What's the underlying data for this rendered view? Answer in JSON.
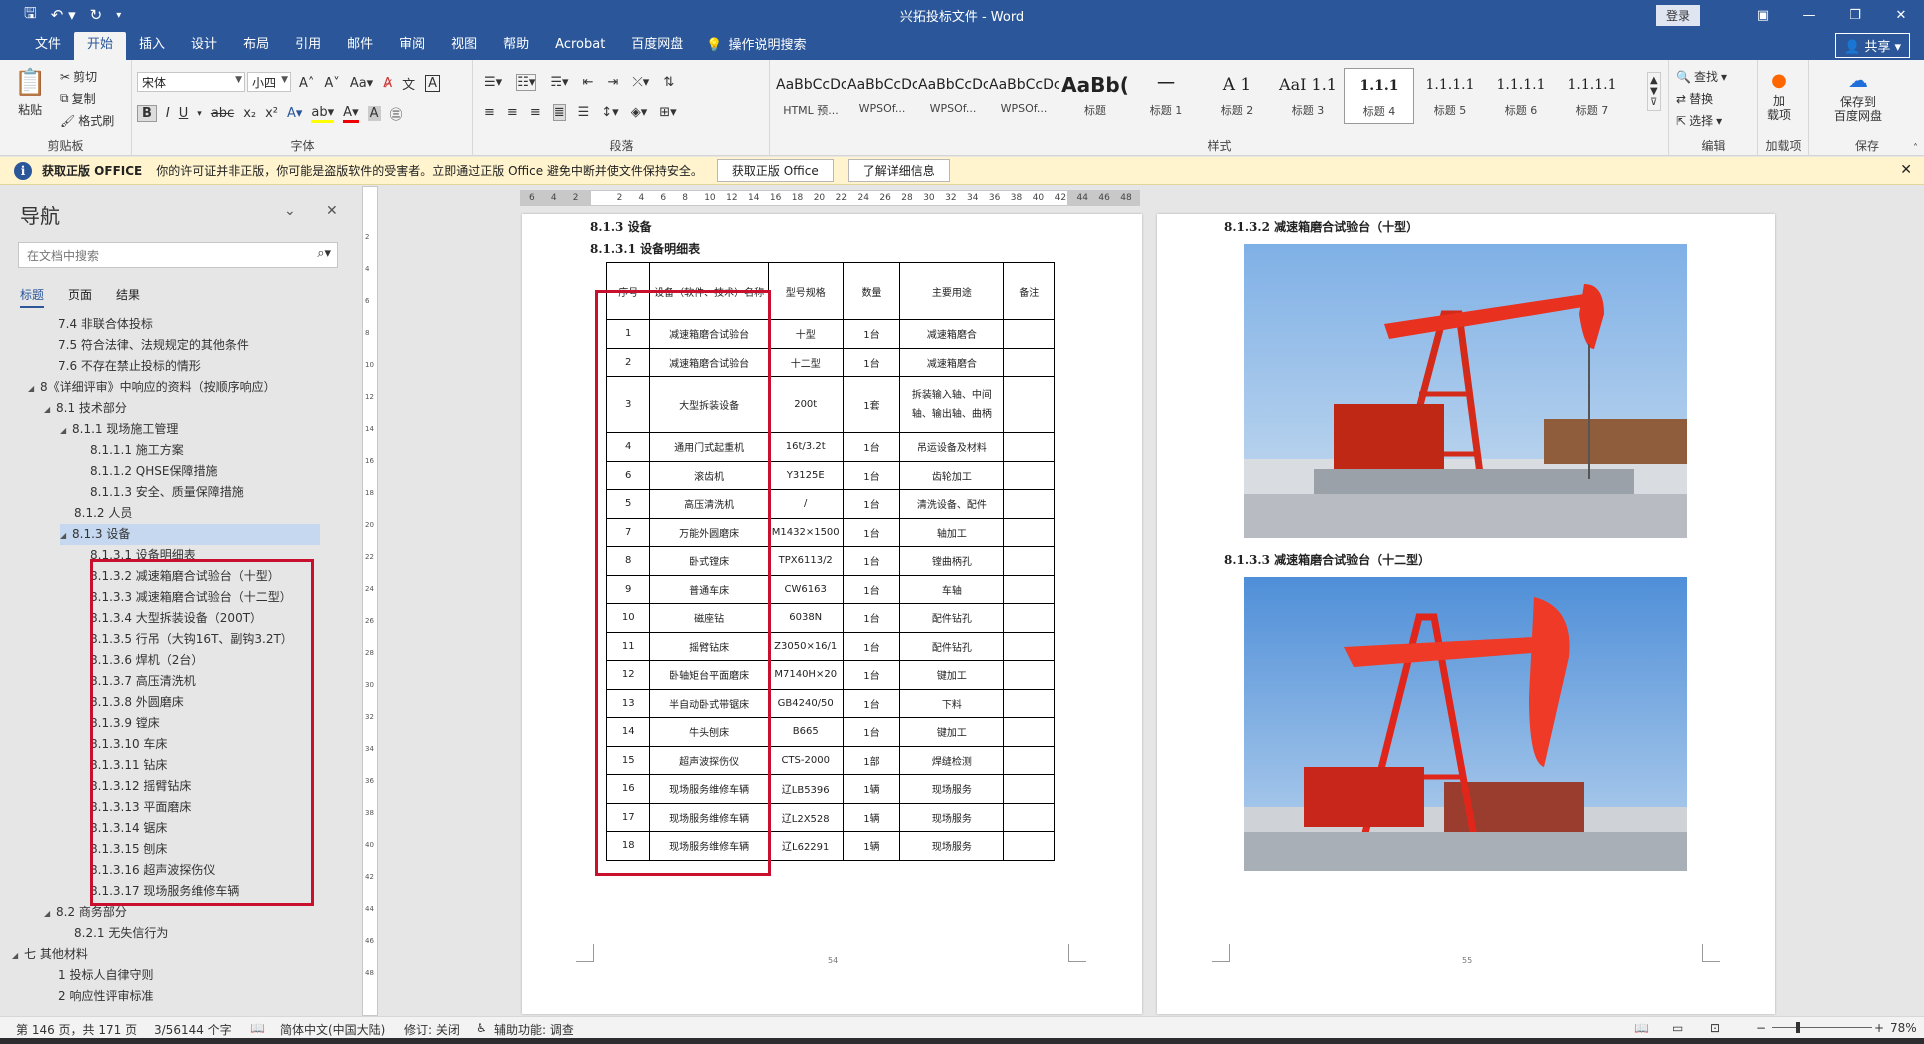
{
  "app": {
    "doc_title": "兴拓投标文件  -  Word",
    "login_label": "登录",
    "share_label": "共享"
  },
  "menu": {
    "tabs": [
      "文件",
      "开始",
      "插入",
      "设计",
      "布局",
      "引用",
      "邮件",
      "审阅",
      "视图",
      "帮助",
      "Acrobat",
      "百度网盘"
    ],
    "active_tab": "开始",
    "tell_me": "操作说明搜索"
  },
  "ribbon": {
    "clipboard": {
      "label": "剪贴板",
      "paste": "粘贴",
      "cut": "剪切",
      "copy": "复制",
      "format_painter": "格式刷"
    },
    "font": {
      "label": "字体",
      "font_name": "宋体",
      "font_size": "小四"
    },
    "paragraph": {
      "label": "段落"
    },
    "styles": {
      "label": "样式",
      "items": [
        {
          "preview": "AaBbCcDc",
          "name": "HTML 预..."
        },
        {
          "preview": "AaBbCcDc",
          "name": "WPSOf..."
        },
        {
          "preview": "AaBbCcDc",
          "name": "WPSOf..."
        },
        {
          "preview": "AaBbCcDc",
          "name": "WPSOf..."
        },
        {
          "preview": "AaBb(",
          "name": "标题"
        },
        {
          "preview": "一",
          "name": "标题 1"
        },
        {
          "preview": "A 1",
          "name": "标题 2"
        },
        {
          "preview": "AaI 1.1",
          "name": "标题 3"
        },
        {
          "preview": "1.1.1",
          "name": "标题 4"
        },
        {
          "preview": "1.1.1.1",
          "name": "标题 5"
        },
        {
          "preview": "1.1.1.1",
          "name": "标题 6"
        },
        {
          "preview": "1.1.1.1",
          "name": "标题 7"
        }
      ],
      "selected_index": 8
    },
    "editing": {
      "label": "编辑",
      "find": "查找",
      "replace": "替换",
      "select": "选择"
    },
    "addins": {
      "label": "加载项",
      "button": "加\n载项"
    },
    "save": {
      "label": "保存",
      "button": "保存到\n百度网盘"
    }
  },
  "infobar": {
    "title": "获取正版 OFFICE",
    "message": "你的许可证并非正版，你可能是盗版软件的受害者。立即通过正版 Office 避免中断并使文件保持安全。",
    "button1": "获取正版 Office",
    "button2": "了解详细信息"
  },
  "nav": {
    "title": "导航",
    "search_placeholder": "在文档中搜索",
    "tabs": [
      "标题",
      "页面",
      "结果"
    ],
    "items": [
      {
        "text": "7.4 非联合体投标",
        "level": 3,
        "tri": ""
      },
      {
        "text": "7.5 符合法律、法规规定的其他条件",
        "level": 3,
        "tri": ""
      },
      {
        "text": "7.6 不存在禁止投标的情形",
        "level": 3,
        "tri": ""
      },
      {
        "text": "8《详细评审》中响应的资料（按顺序响应）",
        "level": 2,
        "tri": "◢"
      },
      {
        "text": "8.1 技术部分",
        "level": 3,
        "tri": "◢"
      },
      {
        "text": "8.1.1 现场施工管理",
        "level": 4,
        "tri": "◢"
      },
      {
        "text": "8.1.1.1 施工方案",
        "level": 5,
        "tri": ""
      },
      {
        "text": "8.1.1.2 QHSE保障措施",
        "level": 5,
        "tri": ""
      },
      {
        "text": "8.1.1.3 安全、质量保障措施",
        "level": 5,
        "tri": ""
      },
      {
        "text": "8.1.2 人员",
        "level": 4,
        "tri": ""
      },
      {
        "text": "8.1.3 设备",
        "level": 4,
        "tri": "◢",
        "selected": true
      },
      {
        "text": "8.1.3.1 设备明细表",
        "level": 5,
        "tri": ""
      },
      {
        "text": "8.1.3.2 减速箱磨合试验台（十型）",
        "level": 5,
        "tri": ""
      },
      {
        "text": "8.1.3.3 减速箱磨合试验台（十二型）",
        "level": 5,
        "tri": ""
      },
      {
        "text": "8.1.3.4 大型拆装设备（200T）",
        "level": 5,
        "tri": ""
      },
      {
        "text": "8.1.3.5 行吊（大钩16T、副钩3.2T）",
        "level": 5,
        "tri": ""
      },
      {
        "text": "8.1.3.6 焊机（2台）",
        "level": 5,
        "tri": ""
      },
      {
        "text": "8.1.3.7 高压清洗机",
        "level": 5,
        "tri": ""
      },
      {
        "text": "8.1.3.8 外圆磨床",
        "level": 5,
        "tri": ""
      },
      {
        "text": "8.1.3.9 镗床",
        "level": 5,
        "tri": ""
      },
      {
        "text": "8.1.3.10 车床",
        "level": 5,
        "tri": ""
      },
      {
        "text": "8.1.3.11 钻床",
        "level": 5,
        "tri": ""
      },
      {
        "text": "8.1.3.12 摇臂钻床",
        "level": 5,
        "tri": ""
      },
      {
        "text": "8.1.3.13 平面磨床",
        "level": 5,
        "tri": ""
      },
      {
        "text": "8.1.3.14 锯床",
        "level": 5,
        "tri": ""
      },
      {
        "text": "8.1.3.15 刨床",
        "level": 5,
        "tri": ""
      },
      {
        "text": "8.1.3.16 超声波探伤仪",
        "level": 5,
        "tri": ""
      },
      {
        "text": "8.1.3.17 现场服务维修车辆",
        "level": 5,
        "tri": ""
      },
      {
        "text": "8.2 商务部分",
        "level": 3,
        "tri": "◢"
      },
      {
        "text": "8.2.1 无失信行为",
        "level": 4,
        "tri": ""
      },
      {
        "text": "七 其他材料",
        "level": 1,
        "tri": "◢"
      },
      {
        "text": "1 投标人自律守则",
        "level": 3,
        "tri": ""
      },
      {
        "text": "2 响应性评审标准",
        "level": 3,
        "tri": ""
      }
    ]
  },
  "ruler": {
    "numbers": [
      "6",
      "4",
      "2",
      "",
      "2",
      "4",
      "6",
      "8",
      "10",
      "12",
      "14",
      "16",
      "18",
      "20",
      "22",
      "24",
      "26",
      "28",
      "30",
      "32",
      "34",
      "36",
      "38",
      "40",
      "42",
      "44",
      "46",
      "48"
    ],
    "vnumbers": [
      "2",
      "4",
      "6",
      "8",
      "10",
      "12",
      "14",
      "16",
      "18",
      "20",
      "22",
      "24",
      "26",
      "28",
      "30",
      "32",
      "34",
      "36",
      "38",
      "40",
      "42",
      "44",
      "46",
      "48"
    ]
  },
  "page_left": {
    "heading1": "8.1.3   设备",
    "heading2": "8.1.3.1     设备明细表",
    "page_number": "54",
    "table": {
      "headers": [
        "序号",
        "设备（软件、技术）名称",
        "型号规格",
        "数量",
        "主要用途",
        "备注"
      ],
      "rows": [
        [
          "1",
          "减速箱磨合试验台",
          "十型",
          "1台",
          "减速箱磨合",
          ""
        ],
        [
          "2",
          "减速箱磨合试验台",
          "十二型",
          "1台",
          "减速箱磨合",
          ""
        ],
        [
          "3",
          "大型拆装设备",
          "200t",
          "1套",
          "拆装输入轴、中间轴、输出轴、曲柄",
          ""
        ],
        [
          "4",
          "通用门式起重机",
          "16t/3.2t",
          "1台",
          "吊运设备及材料",
          ""
        ],
        [
          "6",
          "滚齿机",
          "Y3125E",
          "1台",
          "齿轮加工",
          ""
        ],
        [
          "5",
          "高压清洗机",
          "/",
          "1台",
          "清洗设备、配件",
          ""
        ],
        [
          "7",
          "万能外圆磨床",
          "M1432×1500",
          "1台",
          "轴加工",
          ""
        ],
        [
          "8",
          "卧式镗床",
          "TPX6113/2",
          "1台",
          "镗曲柄孔",
          ""
        ],
        [
          "9",
          "普通车床",
          "CW6163",
          "1台",
          "车轴",
          ""
        ],
        [
          "10",
          "磁座钻",
          "6038N",
          "1台",
          "配件钻孔",
          ""
        ],
        [
          "11",
          "摇臂钻床",
          "Z3050×16/1",
          "1台",
          "配件钻孔",
          ""
        ],
        [
          "12",
          "卧轴矩台平面磨床",
          "M7140H×20",
          "1台",
          "键加工",
          ""
        ],
        [
          "13",
          "半自动卧式带锯床",
          "GB4240/50",
          "1台",
          "下料",
          ""
        ],
        [
          "14",
          "牛头刨床",
          "B665",
          "1台",
          "键加工",
          ""
        ],
        [
          "15",
          "超声波探伤仪",
          "CTS-2000",
          "1部",
          "焊缝检测",
          ""
        ],
        [
          "16",
          "现场服务维修车辆",
          "辽LB5396",
          "1辆",
          "现场服务",
          ""
        ],
        [
          "17",
          "现场服务维修车辆",
          "辽L2X528",
          "1辆",
          "现场服务",
          ""
        ],
        [
          "18",
          "现场服务维修车辆",
          "辽L62291",
          "1辆",
          "现场服务",
          ""
        ]
      ]
    }
  },
  "page_right": {
    "heading1": "8.1.3.2      减速箱磨合试验台（十型）",
    "heading2": "8.1.3.3      减速箱磨合试验台（十二型）",
    "page_number": "55"
  },
  "status": {
    "page": "第 146 页，共 171 页",
    "words": "3/56144 个字",
    "language": "简体中文(中国大陆)",
    "track": "修订: 关闭",
    "accessibility": "辅助功能: 调查",
    "zoom": "78%"
  },
  "colors": {
    "brand": "#2b579a",
    "highlight_box": "#c8102e",
    "info_bg": "#fff4ce"
  }
}
